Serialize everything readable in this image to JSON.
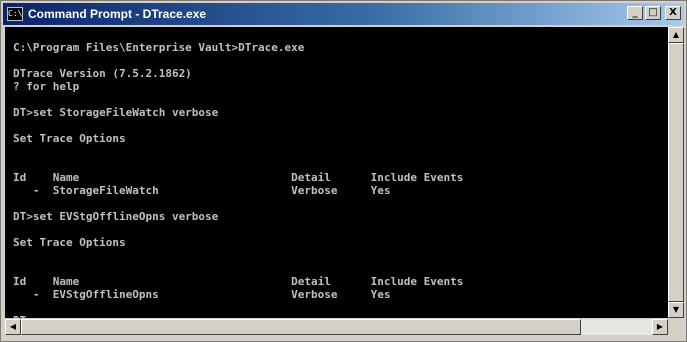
{
  "window": {
    "title": "Command Prompt - DTrace.exe",
    "icon_label": "C:\\",
    "minimize_glyph": "_",
    "maximize_glyph": "□",
    "close_glyph": "X"
  },
  "console": {
    "lines": [
      "C:\\Program Files\\Enterprise Vault>DTrace.exe",
      "",
      "DTrace Version (7.5.2.1862)",
      "? for help",
      "",
      "DT>set StorageFileWatch verbose",
      "",
      "Set Trace Options",
      "",
      "",
      "Id    Name                                Detail      Include Events",
      "   -  StorageFileWatch                    Verbose     Yes",
      "",
      "DT>set EVStgOfflineOpns verbose",
      "",
      "Set Trace Options",
      "",
      "",
      "Id    Name                                Detail      Include Events",
      "   -  EVStgOfflineOpns                    Verbose     Yes",
      "",
      "DT>"
    ]
  },
  "scrollbars": {
    "up_glyph": "▲",
    "down_glyph": "▼",
    "left_glyph": "◀",
    "right_glyph": "▶"
  },
  "colors": {
    "console_bg": "#000000",
    "console_fg": "#c0c0c0",
    "titlebar_start": "#0a246a",
    "titlebar_end": "#a6caf0"
  }
}
